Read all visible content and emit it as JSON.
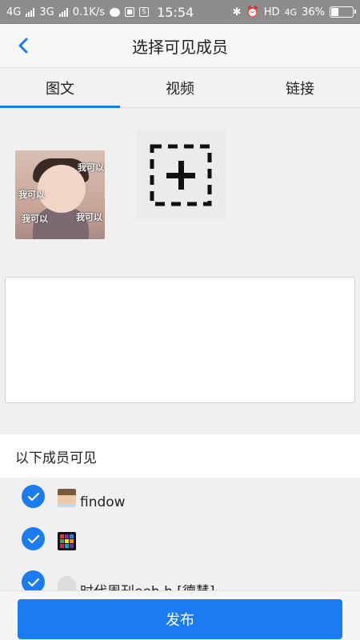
{
  "status_bar": {
    "left_network_1": "4G",
    "left_network_2": "3G",
    "speed": "0.1K/s",
    "time": "15:54",
    "hd_label": "HD",
    "network_4g": "4G",
    "battery": "36%"
  },
  "header": {
    "title": "选择可见成员"
  },
  "tabs": [
    {
      "label": "图文",
      "active": true
    },
    {
      "label": "视频",
      "active": false
    },
    {
      "label": "链接",
      "active": false
    }
  ],
  "image_captions": [
    "我可以",
    "我可以",
    "我可以",
    "我可以"
  ],
  "members_header": "以下成员可见",
  "members": [
    {
      "name": "findow",
      "checked": true
    },
    {
      "name": "",
      "checked": true
    },
    {
      "name": "时代周刊eeh.h [德慧]",
      "checked": true
    }
  ],
  "publish_label": "发布",
  "colors": {
    "accent": "#1a7cf0",
    "status_bar": "#8d8d8d"
  }
}
